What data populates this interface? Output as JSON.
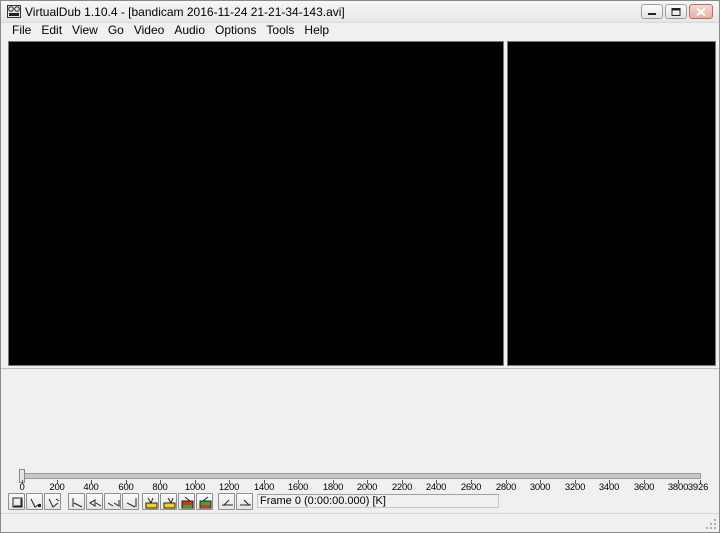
{
  "window": {
    "title": "VirtualDub 1.10.4 - [bandicam 2016-11-24 21-21-34-143.avi]"
  },
  "menu": [
    "File",
    "Edit",
    "View",
    "Go",
    "Video",
    "Audio",
    "Options",
    "Tools",
    "Help"
  ],
  "timeline": {
    "position": 0,
    "max": 3926,
    "ticks": [
      "0",
      "200",
      "400",
      "600",
      "800",
      "1000",
      "1200",
      "1400",
      "1600",
      "1800",
      "2000",
      "2200",
      "2400",
      "2600",
      "2800",
      "3000",
      "3200",
      "3400",
      "3600",
      "3800",
      "3926"
    ]
  },
  "toolbar": {
    "buttons": [
      {
        "name": "stop-button",
        "icon": "stop-icon"
      },
      {
        "name": "play-input-button",
        "icon": "play-input-icon"
      },
      {
        "name": "play-output-button",
        "icon": "play-output-icon"
      },
      {
        "name": "go-to-start-button",
        "icon": "go-start-icon"
      },
      {
        "name": "previous-frame-button",
        "icon": "prev-frame-icon"
      },
      {
        "name": "next-frame-button",
        "icon": "next-frame-icon"
      },
      {
        "name": "go-to-end-button",
        "icon": "go-end-icon"
      },
      {
        "name": "previous-keyframe-button",
        "icon": "prev-key-icon"
      },
      {
        "name": "next-keyframe-button",
        "icon": "next-key-icon"
      },
      {
        "name": "previous-scene-button",
        "icon": "prev-scene-icon"
      },
      {
        "name": "next-scene-button",
        "icon": "next-scene-icon"
      },
      {
        "name": "mark-in-button",
        "icon": "mark-in-icon"
      },
      {
        "name": "mark-out-button",
        "icon": "mark-out-icon"
      }
    ]
  },
  "status": {
    "frame_text": "Frame 0 (0:00:00.000) [K]"
  },
  "colors": {
    "pane_bg": "#000000",
    "window_bg": "#f0f0f0",
    "icon_yellow": "#f2d21b",
    "icon_red": "#d8331c",
    "icon_green": "#3aa63a"
  }
}
